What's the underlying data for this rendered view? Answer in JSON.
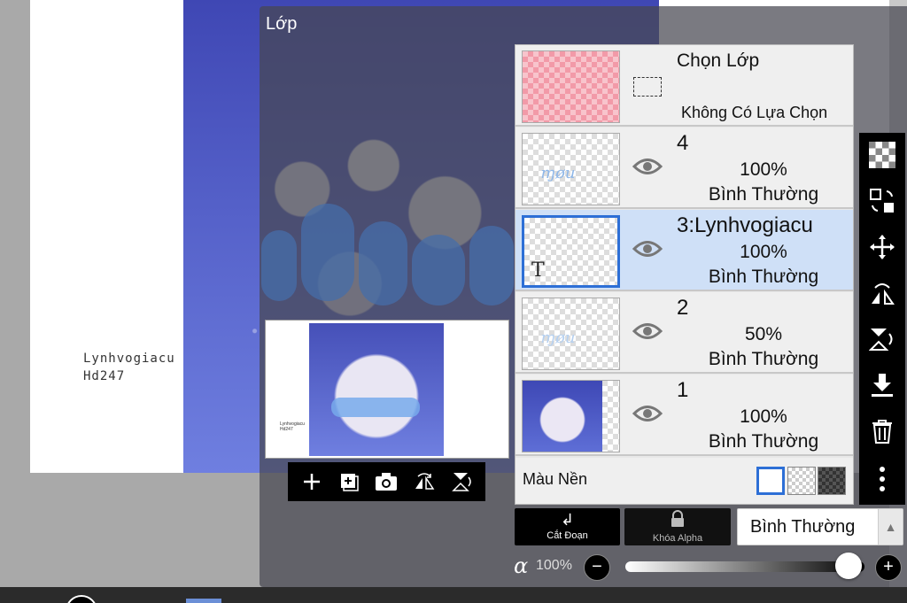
{
  "canvas": {
    "signature_line1": "Lynhvogiacu",
    "signature_line2": "Hd247"
  },
  "overlay": {
    "title": "Lớp"
  },
  "thumbnail_tools": [
    {
      "icon": "plus-icon"
    },
    {
      "icon": "add-layer-icon"
    },
    {
      "icon": "camera-icon"
    },
    {
      "icon": "flip-horizontal-icon"
    },
    {
      "icon": "flip-vertical-icon"
    }
  ],
  "selection_layer": {
    "title": "Chọn Lớp",
    "subtitle": "Không Có Lựa Chọn"
  },
  "layers": [
    {
      "name": "4",
      "opacity": "100%",
      "mode": "Bình Thường",
      "selected": false
    },
    {
      "name": "3:Lynhvogiacu",
      "opacity": "100%",
      "mode": "Bình Thường",
      "selected": true
    },
    {
      "name": "2",
      "opacity": "50%",
      "mode": "Bình Thường",
      "selected": false
    },
    {
      "name": "1",
      "opacity": "100%",
      "mode": "Bình Thường",
      "selected": false
    }
  ],
  "background": {
    "label": "Màu Nền"
  },
  "right_toolbar": [
    {
      "icon": "checkerboard-icon"
    },
    {
      "icon": "transform-icon"
    },
    {
      "icon": "move-icon"
    },
    {
      "icon": "flip-horizontal-icon"
    },
    {
      "icon": "flip-vertical-icon"
    },
    {
      "icon": "merge-down-icon"
    },
    {
      "icon": "trash-icon"
    },
    {
      "icon": "more-icon"
    }
  ],
  "controls": {
    "clip_label": "Cắt Đoạn",
    "alpha_lock_label": "Khóa Alpha",
    "blend_mode": "Bình Thường",
    "alpha_symbol": "α",
    "opacity_value": "100%",
    "opacity_fraction": 1.0,
    "minus": "−",
    "plus": "+"
  },
  "colors": {
    "accent": "#2d6fd6",
    "selected_row": "#cfe0f7"
  }
}
